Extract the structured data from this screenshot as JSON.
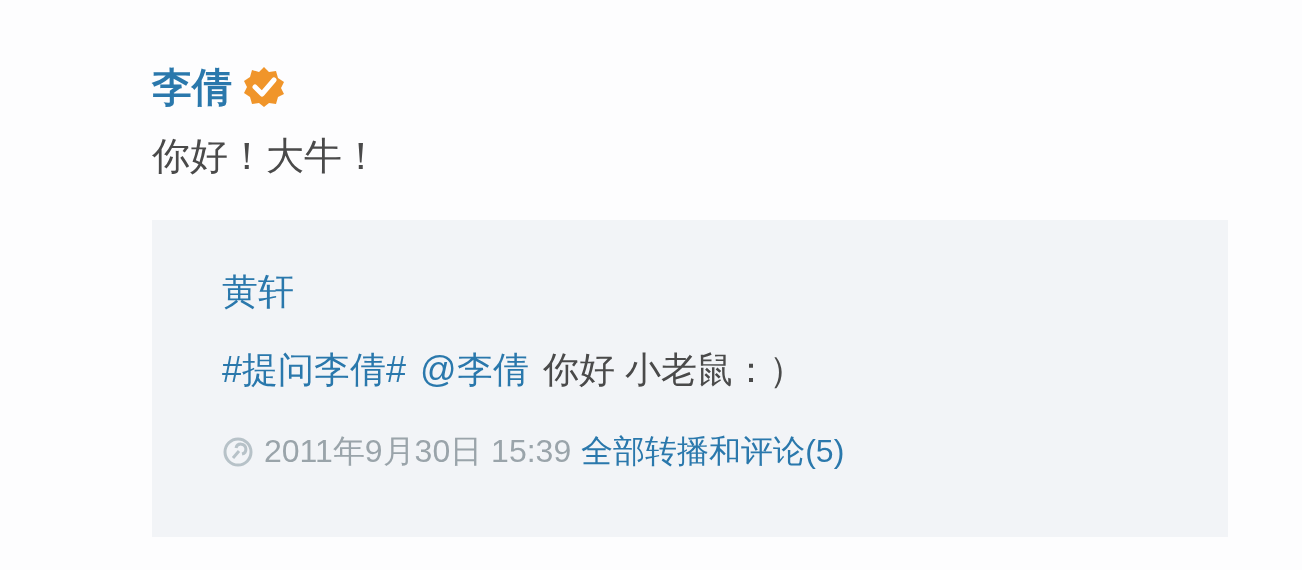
{
  "post": {
    "author": "李倩",
    "verified": true,
    "text": "你好！大牛！"
  },
  "repost": {
    "author": "黄轩",
    "text_parts": [
      {
        "kind": "topic",
        "text": "#提问李倩#"
      },
      {
        "kind": "mention",
        "text": "@李倩"
      },
      {
        "kind": "text",
        "text": "你好 小老鼠：）"
      }
    ],
    "time": "2011年9月30日 15:39",
    "link": "全部转播和评论(5)"
  }
}
